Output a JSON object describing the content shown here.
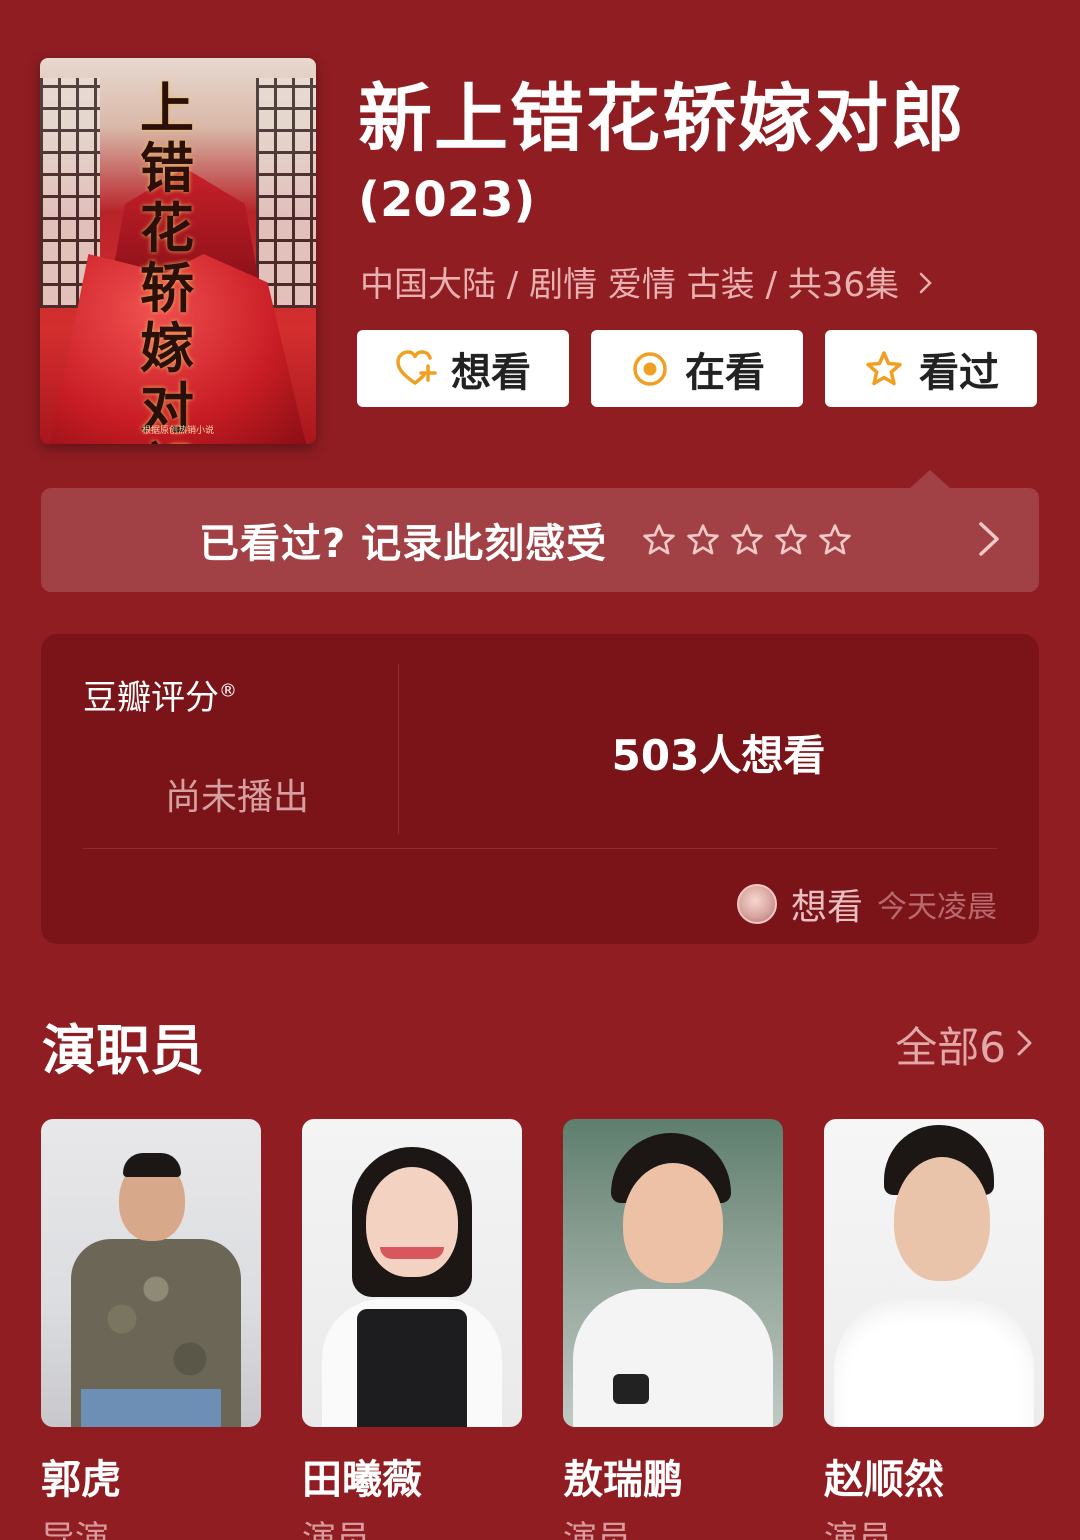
{
  "movie": {
    "title": "新上错花轿嫁对郎",
    "year": "(2023)",
    "meta": "中国大陆 / 剧情 爱情 古装 / 共36集",
    "poster_text": "上错花轿嫁对郎",
    "poster_credit": "根据原创热销小说"
  },
  "actions": [
    {
      "label": "想看",
      "icon": "heart-plus-icon"
    },
    {
      "label": "在看",
      "icon": "target-icon"
    },
    {
      "label": "看过",
      "icon": "star-outline-icon"
    }
  ],
  "record": {
    "prompt": "已看过? 记录此刻感受",
    "stars": 5
  },
  "rating": {
    "label": "豆瓣评分",
    "reg": "®",
    "status": "尚未播出",
    "want_count": "503人想看",
    "recent_action": "想看",
    "recent_time": "今天凌晨"
  },
  "cast": {
    "heading": "演职员",
    "all_label": "全部6",
    "members": [
      {
        "name": "郭虎",
        "role": "导演"
      },
      {
        "name": "田曦薇",
        "role": "演员"
      },
      {
        "name": "敖瑞鹏",
        "role": "演员"
      },
      {
        "name": "赵顺然",
        "role": "演员"
      }
    ]
  },
  "colors": {
    "background": "#8f1d22",
    "card": "#7a1419",
    "accent_gold": "#f0a020",
    "muted": "#d89a9c"
  }
}
